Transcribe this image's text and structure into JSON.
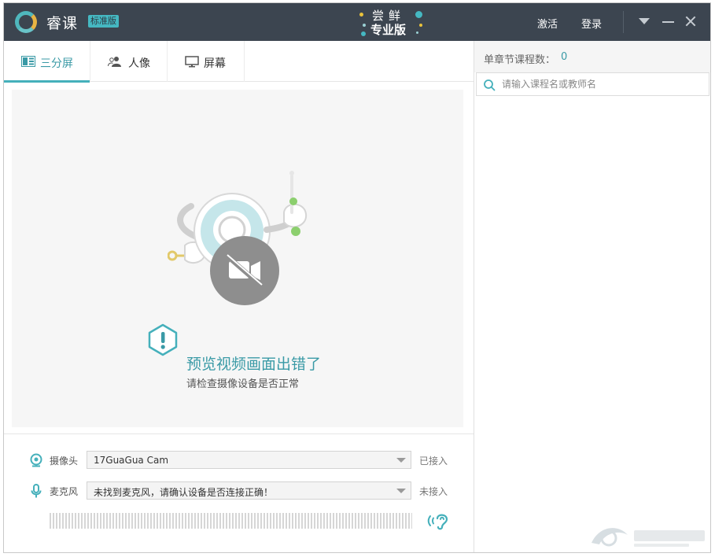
{
  "titlebar": {
    "app_name": "睿课",
    "edition_badge": "标准版",
    "promo_line1": "尝鲜",
    "promo_line2": "专业版",
    "activate_label": "激活",
    "login_label": "登录"
  },
  "tabs": [
    {
      "label": "三分屏",
      "icon": "split-screen-icon",
      "active": true
    },
    {
      "label": "人像",
      "icon": "portrait-icon",
      "active": false
    },
    {
      "label": "屏幕",
      "icon": "monitor-icon",
      "active": false
    }
  ],
  "preview": {
    "error_title": "预览视频画面出错了",
    "error_subtitle": "请检查摄像设备是否正常"
  },
  "devices": {
    "camera": {
      "label": "摄像头",
      "value": "17GuaGua Cam",
      "status": "已接入"
    },
    "microphone": {
      "label": "麦克风",
      "value": "未找到麦克风，请确认设备是否连接正确！",
      "status": "未接入"
    }
  },
  "sidebar": {
    "count_label": "单章节课程数：",
    "count_value": "0",
    "search_placeholder": "请输入课程名或教师名"
  },
  "colors": {
    "titlebar_bg": "#3c4550",
    "accent": "#45b0bb",
    "accent_text": "#3a9aa6"
  }
}
